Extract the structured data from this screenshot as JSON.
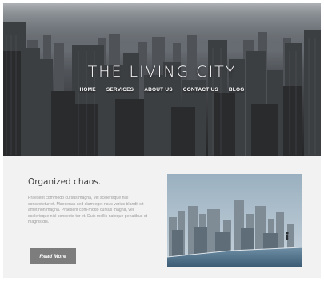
{
  "hero": {
    "title": "THE LIVING CITY",
    "nav": [
      "HOME",
      "SERVICES",
      "ABOUT US",
      "CONTACT US",
      "BLOG"
    ]
  },
  "section": {
    "heading": "Organized chaos.",
    "body": "Praesent commodo cursus magna, vel scelerisque nisl consectetur et. Maecenas sed diam eget risus varius blandit sit amet non magna. Praesent com-modo cursus magna, vel scelerisque nisl consecte-tur et. Duis mollis natoque penatibus et magnis dis.",
    "button_label": "Read More"
  },
  "images": {
    "hero_background": "city-skyline-photo",
    "section_photo": "rooftop-infinity-pool-photo"
  }
}
